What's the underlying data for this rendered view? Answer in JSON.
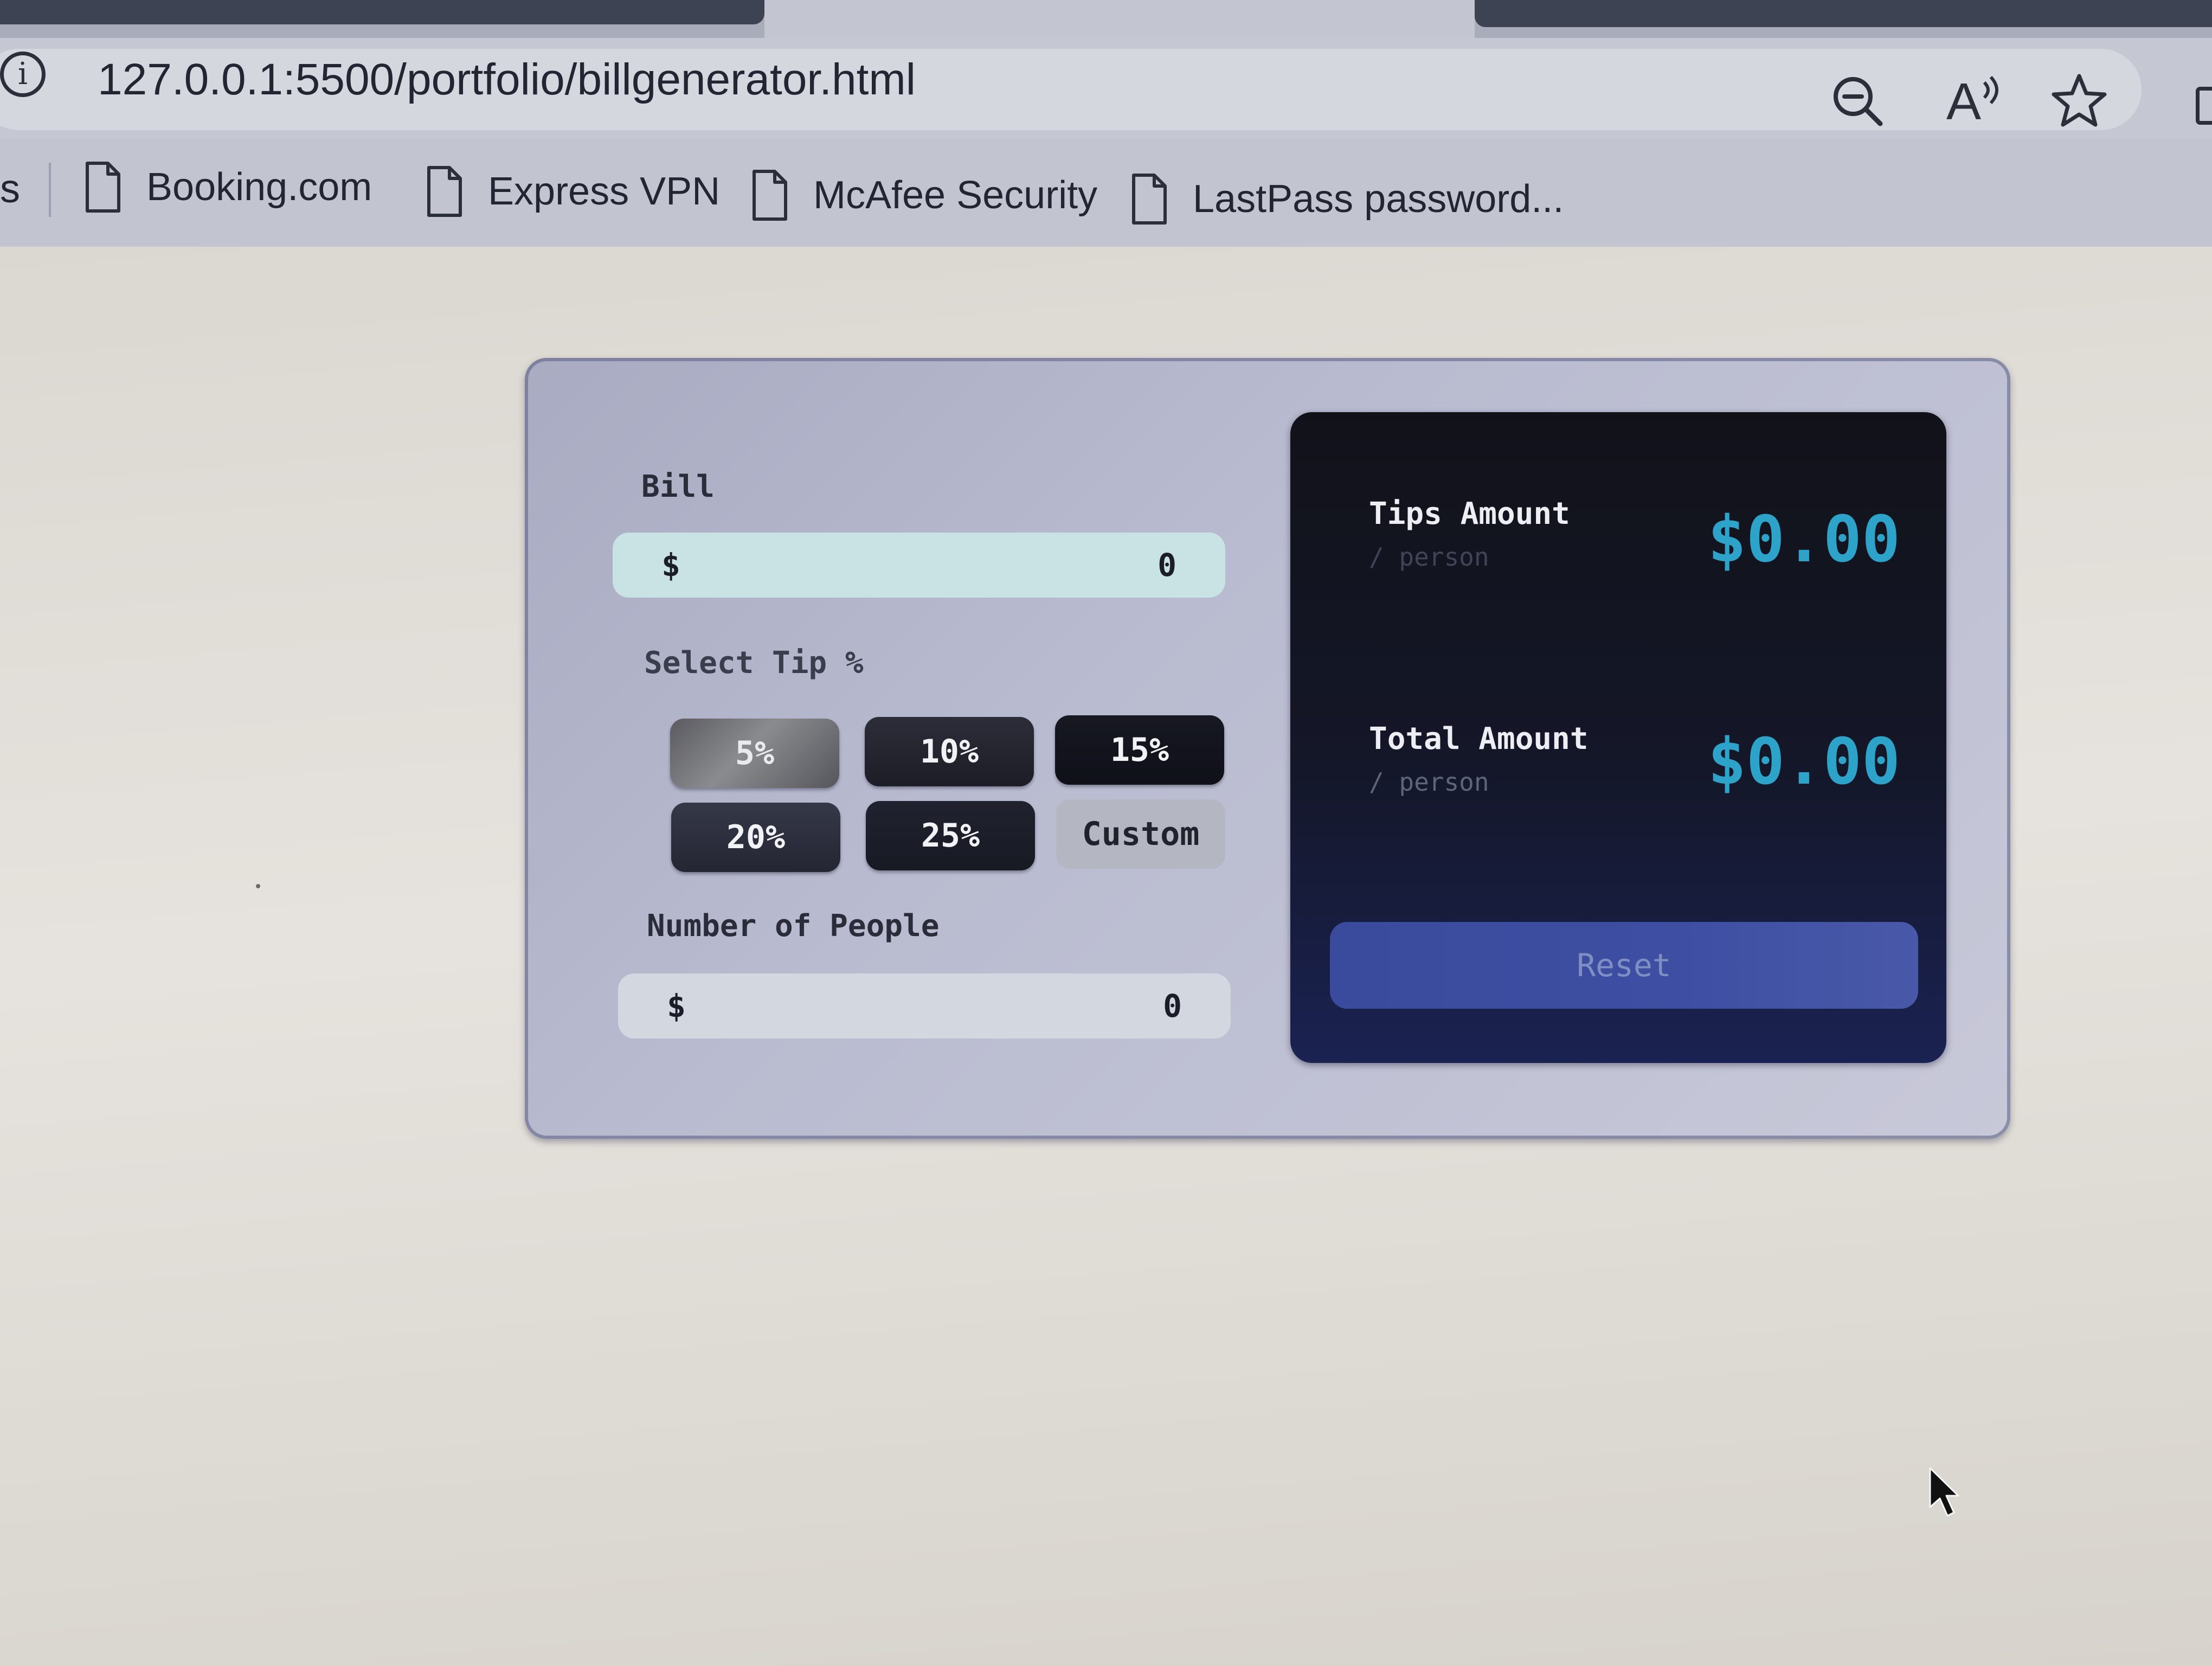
{
  "browser": {
    "url": "127.0.0.1:5500/portfolio/billgenerator.html",
    "read_aloud_label": "A¹¹",
    "icons": {
      "site_info": "info-icon",
      "zoom": "zoom-out-icon",
      "read_aloud": "read-aloud-icon",
      "favorite": "star-icon",
      "sidebar": "sidebar-icon"
    }
  },
  "bookmarks": {
    "partial_label": "s",
    "items": [
      {
        "label": "Booking.com",
        "icon": "document-icon"
      },
      {
        "label": "Express VPN",
        "icon": "document-icon"
      },
      {
        "label": "McAfee Security",
        "icon": "document-icon"
      },
      {
        "label": "LastPass password...",
        "icon": "document-icon"
      }
    ]
  },
  "calculator": {
    "bill": {
      "label": "Bill",
      "currency": "$",
      "value": "0"
    },
    "tip": {
      "label": "Select Tip %",
      "options": [
        "5%",
        "10%",
        "15%",
        "20%",
        "25%",
        "Custom"
      ],
      "selected": "5%"
    },
    "people": {
      "label": "Number of People",
      "currency": "$",
      "value": "0"
    },
    "results": {
      "tips": {
        "title": "Tips Amount",
        "subtitle": "/ person",
        "value": "$0.00"
      },
      "total": {
        "title": "Total Amount",
        "subtitle": "/ person",
        "value": "$0.00"
      },
      "reset_label": "Reset"
    }
  },
  "colors": {
    "accent_value": "#2ea3c9",
    "result_panel": "#141729",
    "reset_button": "#3e4fa3",
    "bill_field": "#c9e2e3"
  }
}
